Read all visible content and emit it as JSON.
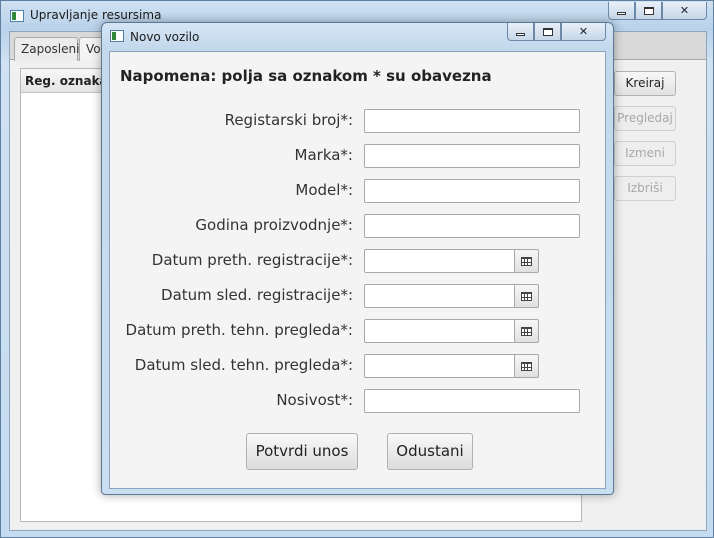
{
  "main_window": {
    "title": "Upravljanje resursima",
    "tabs": [
      {
        "label": "Zaposleni"
      },
      {
        "label": "Vozila"
      }
    ],
    "table": {
      "columns": [
        "Reg. oznaka"
      ]
    },
    "buttons": {
      "create": "Kreiraj",
      "view": "Pregledaj",
      "edit": "Izmeni",
      "delete": "Izbriši"
    }
  },
  "dialog": {
    "title": "Novo vozilo",
    "note": "Napomena: polja sa oznakom * su obavezna",
    "fields": {
      "reg_number": {
        "label": "Registarski broj*:",
        "value": ""
      },
      "brand": {
        "label": "Marka*:",
        "value": ""
      },
      "model": {
        "label": "Model*:",
        "value": ""
      },
      "production_year": {
        "label": "Godina proizvodnje*:",
        "value": ""
      },
      "prev_registration_date": {
        "label": "Datum preth. registracije*:",
        "value": ""
      },
      "next_registration_date": {
        "label": "Datum sled. registracije*:",
        "value": ""
      },
      "prev_inspection_date": {
        "label": "Datum preth. tehn. pregleda*:",
        "value": ""
      },
      "next_inspection_date": {
        "label": "Datum sled. tehn. pregleda*:",
        "value": ""
      },
      "capacity": {
        "label": "Nosivost*:",
        "value": ""
      }
    },
    "buttons": {
      "confirm": "Potvrdi unos",
      "cancel": "Odustani"
    }
  },
  "icons": {
    "app": "app-window-icon",
    "calendar": "calendar-icon"
  },
  "colors": {
    "title_bar": "#c3d8ec",
    "accent_border": "#5b7896",
    "disabled_text": "#a8a8a8"
  }
}
